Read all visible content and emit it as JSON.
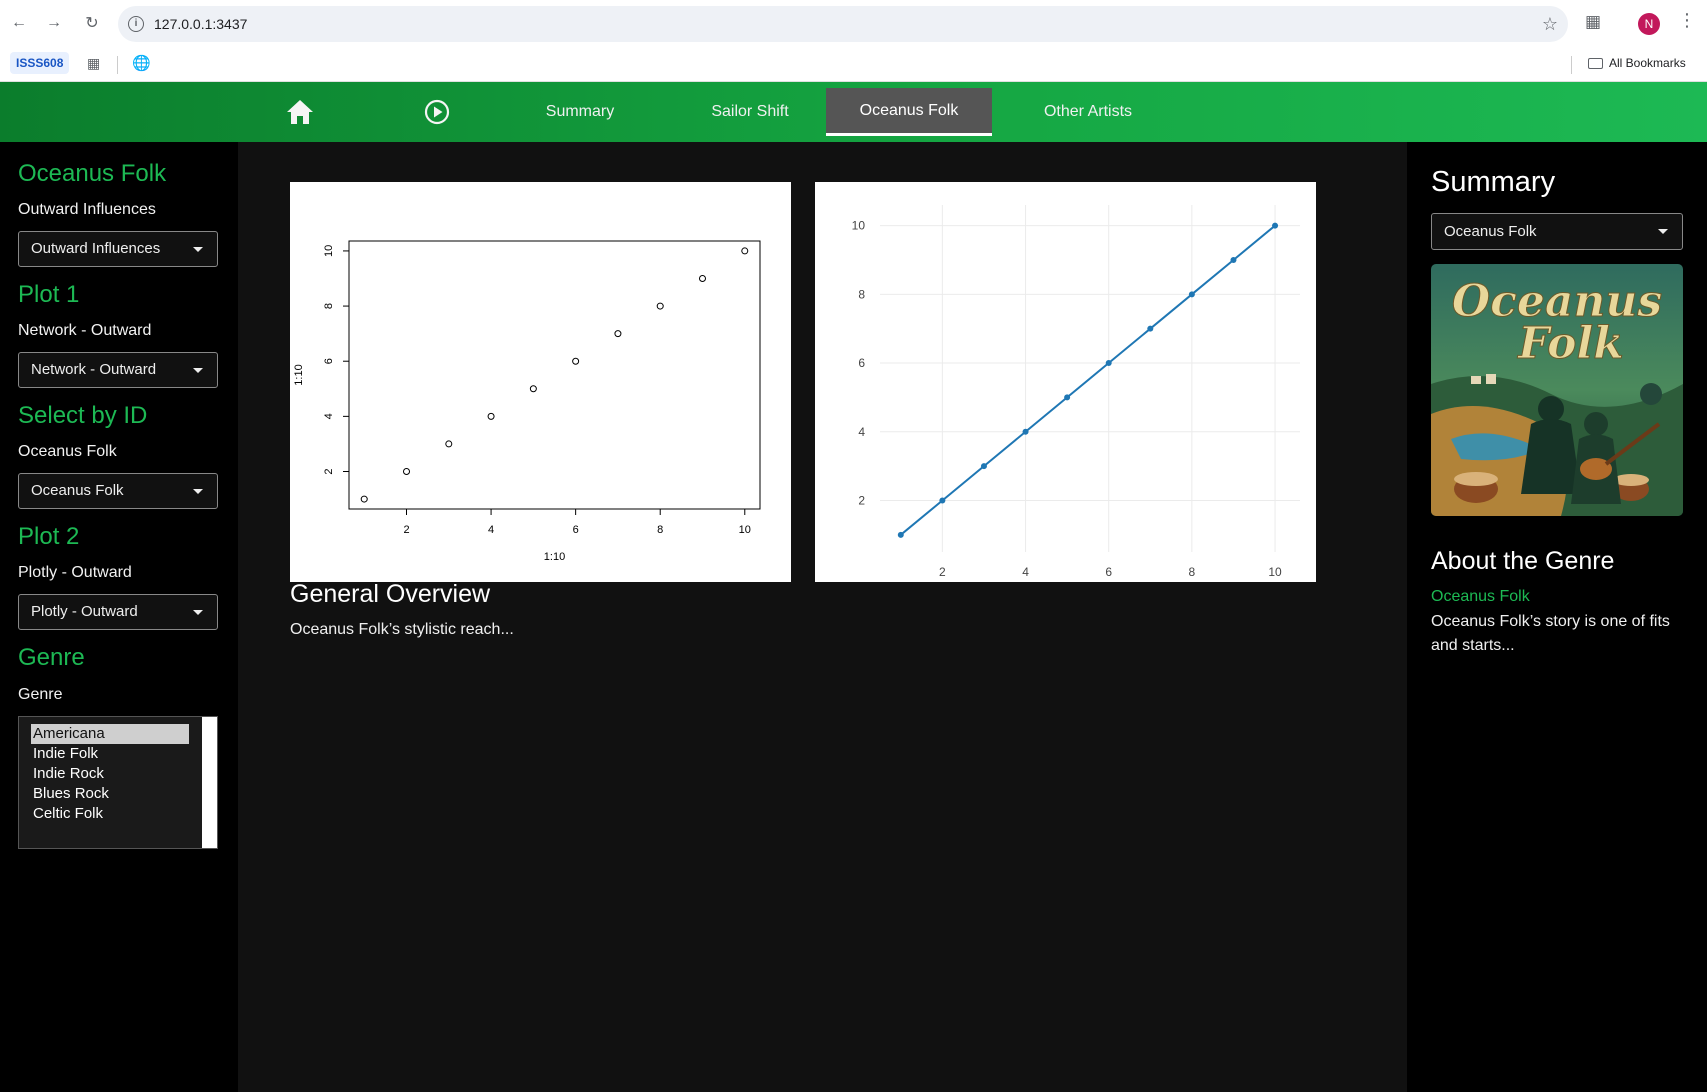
{
  "browser": {
    "url": "127.0.0.1:3437",
    "profile_initial": "N",
    "bookmarks": {
      "chip": "ISSS608",
      "all_bookmarks": "All Bookmarks"
    }
  },
  "nav": {
    "tabs": [
      {
        "label": "Summary"
      },
      {
        "label": "Sailor Shift"
      },
      {
        "label": "Oceanus Folk",
        "active": true
      },
      {
        "label": "Other Artists"
      }
    ]
  },
  "sidebar": {
    "title": "Oceanus Folk",
    "outward": {
      "label": "Outward Influences",
      "value": "Outward Influences"
    },
    "plot1": {
      "heading": "Plot 1",
      "label": "Network - Outward",
      "value": "Network - Outward"
    },
    "select_id": {
      "heading": "Select by ID",
      "label": "Oceanus Folk",
      "value": "Oceanus Folk"
    },
    "plot2": {
      "heading": "Plot 2",
      "label": "Plotly - Outward",
      "value": "Plotly - Outward"
    },
    "genre": {
      "heading": "Genre",
      "label": "Genre",
      "options": [
        "Americana",
        "Indie Folk",
        "Indie Rock",
        "Blues Rock",
        "Celtic Folk"
      ],
      "selected": "Americana"
    }
  },
  "main": {
    "overview_title": "General Overview",
    "overview_text": "Oceanus Folk’s stylistic reach..."
  },
  "right": {
    "title": "Summary",
    "select_value": "Oceanus Folk",
    "art_text_1": "Oceanus",
    "art_text_2": "Folk",
    "about_title": "About the Genre",
    "genre_name": "Oceanus Folk",
    "description": "Oceanus Folk’s story is one of fits and starts..."
  },
  "chart_data": [
    {
      "type": "scatter",
      "x": [
        1,
        2,
        3,
        4,
        5,
        6,
        7,
        8,
        9,
        10
      ],
      "y": [
        1,
        2,
        3,
        4,
        5,
        6,
        7,
        8,
        9,
        10
      ],
      "xlabel": "1:10",
      "ylabel": "1:10",
      "xticks": [
        2,
        4,
        6,
        8,
        10
      ],
      "yticks": [
        2,
        4,
        6,
        8,
        10
      ],
      "xlim": [
        0.64,
        10.36
      ],
      "ylim": [
        0.64,
        10.36
      ],
      "grid": false
    },
    {
      "type": "line",
      "x": [
        1,
        2,
        3,
        4,
        5,
        6,
        7,
        8,
        9,
        10
      ],
      "y": [
        1,
        2,
        3,
        4,
        5,
        6,
        7,
        8,
        9,
        10
      ],
      "xticks": [
        2,
        4,
        6,
        8,
        10
      ],
      "yticks": [
        2,
        4,
        6,
        8,
        10
      ],
      "xlim": [
        0.5,
        10.6
      ],
      "ylim": [
        0.5,
        10.6
      ],
      "grid": true,
      "color": "#1f77b4"
    }
  ]
}
